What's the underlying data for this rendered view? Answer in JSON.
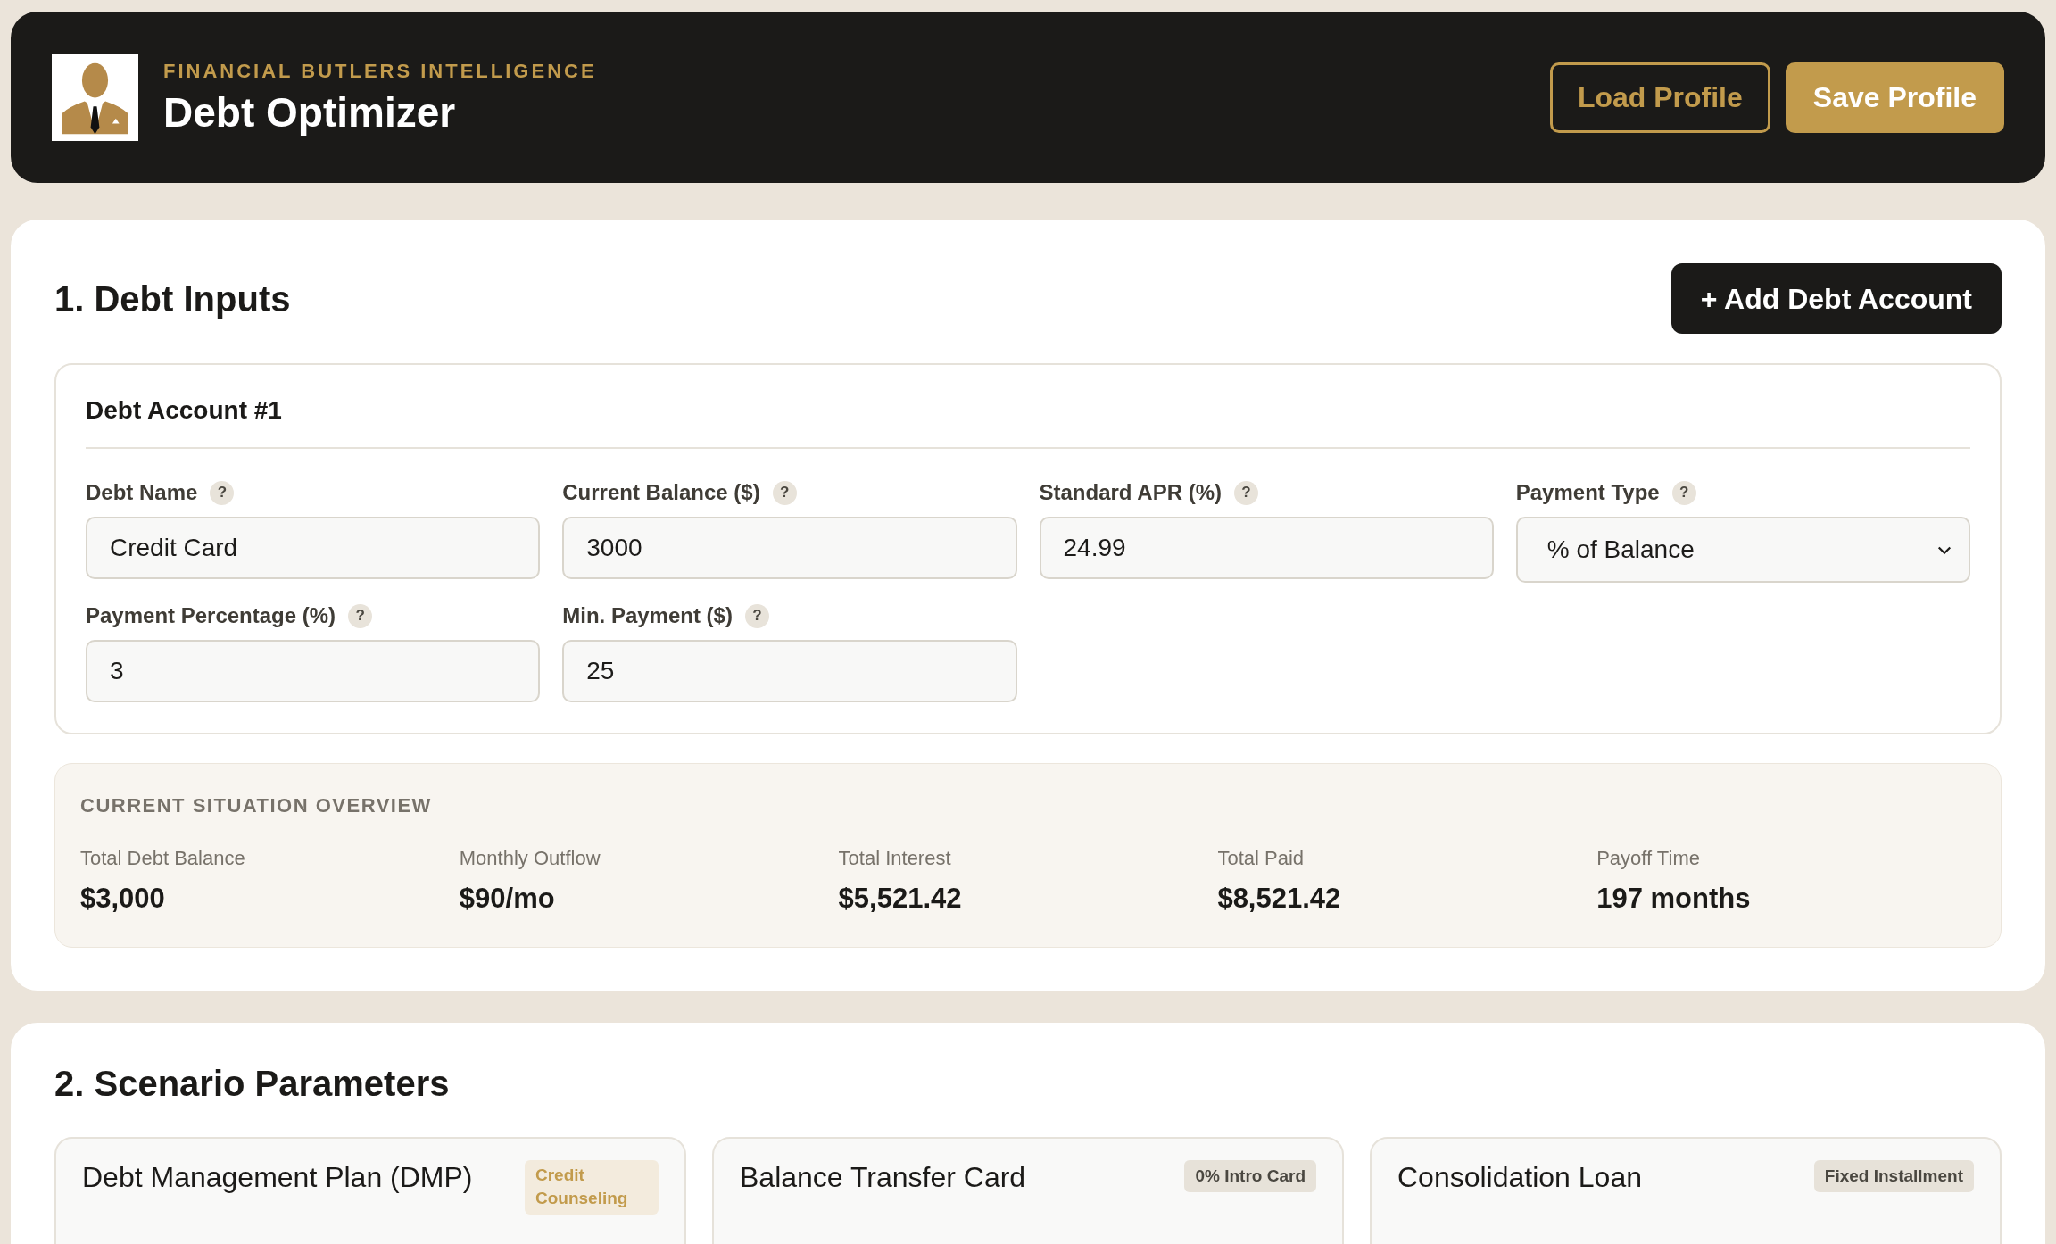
{
  "header": {
    "eyebrow": "FINANCIAL BUTLERS INTELLIGENCE",
    "title": "Debt Optimizer",
    "buttons": [
      {
        "label": "Load Profile",
        "kind": "outline"
      },
      {
        "label": "Save Profile",
        "kind": "filled"
      }
    ]
  },
  "debt_inputs": {
    "title": "1. Debt Inputs",
    "add_button": "+ Add Debt Account",
    "accounts": [
      {
        "title": "Debt Account #1",
        "fields": [
          {
            "kind": "input",
            "label": "Debt Name",
            "help": "?",
            "value": "Credit Card"
          },
          {
            "kind": "input",
            "label": "Current Balance ($)",
            "help": "?",
            "value": "3000"
          },
          {
            "kind": "input",
            "label": "Standard APR (%)",
            "help": "?",
            "value": "24.99"
          },
          {
            "kind": "select",
            "label": "Payment Type",
            "help": "?",
            "value": "% of Balance"
          },
          {
            "kind": "input",
            "label": "Payment Percentage (%)",
            "help": "?",
            "value": "3"
          },
          {
            "kind": "input",
            "label": "Min. Payment ($)",
            "help": "?",
            "value": "25"
          }
        ]
      }
    ],
    "overview": {
      "title": "CURRENT SITUATION OVERVIEW",
      "stats": [
        {
          "label": "Total Debt Balance",
          "value": "$3,000"
        },
        {
          "label": "Monthly Outflow",
          "value": "$90/mo"
        },
        {
          "label": "Total Interest",
          "value": "$5,521.42"
        },
        {
          "label": "Total Paid",
          "value": "$8,521.42"
        },
        {
          "label": "Payoff Time",
          "value": "197 months"
        }
      ]
    }
  },
  "scenario_parameters": {
    "title": "2. Scenario Parameters",
    "cards": [
      {
        "title": "Debt Management Plan (DMP)",
        "tag": "Credit Counseling",
        "kind": "gold"
      },
      {
        "title": "Balance Transfer Card",
        "tag": "0% Intro Card",
        "kind": "gray"
      },
      {
        "title": "Consolidation Loan",
        "tag": "Fixed Installment",
        "kind": "gray"
      }
    ]
  }
}
